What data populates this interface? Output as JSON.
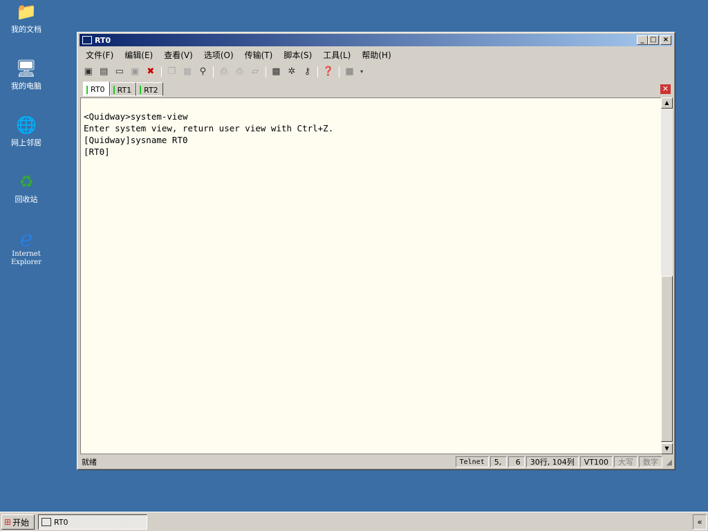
{
  "desktop": {
    "icons": [
      {
        "label": "我的文档",
        "glyph": "📁"
      },
      {
        "label": "我的电脑",
        "glyph": "🖥"
      },
      {
        "label": "网上邻居",
        "glyph": "🌐"
      },
      {
        "label": "回收站",
        "glyph": "♻"
      },
      {
        "label": "Internet Explorer",
        "glyph": "e"
      }
    ]
  },
  "window": {
    "title": "RT0",
    "menu": [
      "文件(F)",
      "编辑(E)",
      "查看(V)",
      "选项(O)",
      "传输(T)",
      "脚本(S)",
      "工具(L)",
      "帮助(H)"
    ],
    "tabs": [
      "RT0",
      "RT1",
      "RT2"
    ],
    "terminal": [
      "<Quidway>system-view",
      "Enter system view, return user view with Ctrl+Z.",
      "[Quidway]sysname RT0",
      "[RT0]"
    ],
    "status": {
      "left": "就绪",
      "protocol": "Telnet",
      "row": "5,",
      "col": "6",
      "size": "30行, 104列",
      "emulation": "VT100",
      "caps": "大写",
      "num": "数字"
    }
  },
  "taskbar": {
    "start": "开始",
    "task": "RT0",
    "tray": "«"
  }
}
